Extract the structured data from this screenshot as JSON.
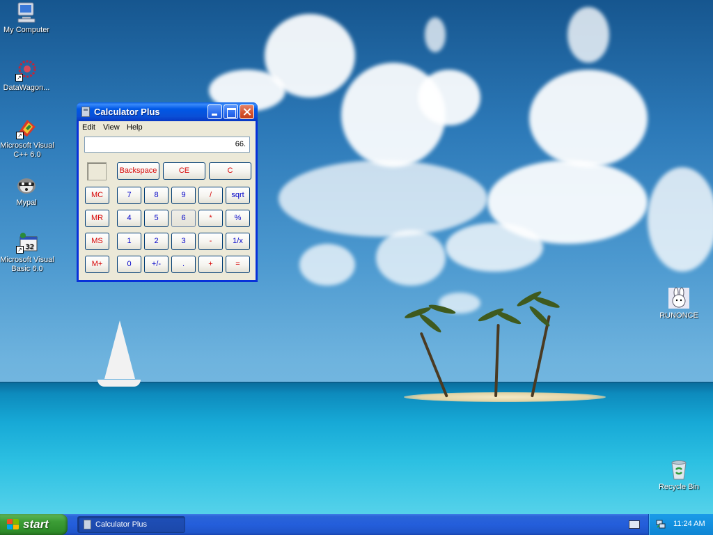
{
  "desktop": {
    "icons": [
      {
        "label": "My Computer"
      },
      {
        "label": "DataWagon..."
      },
      {
        "label": "Microsoft Visual C++ 6.0"
      },
      {
        "label": "Mypal"
      },
      {
        "label": "Microsoft Visual Basic 6.0"
      },
      {
        "label": "RUNONCE"
      },
      {
        "label": "Recycle Bin"
      }
    ]
  },
  "calculator": {
    "title": "Calculator Plus",
    "menu": [
      "Edit",
      "View",
      "Help"
    ],
    "display": "66.",
    "buttons": {
      "backspace": "Backspace",
      "ce": "CE",
      "c": "C",
      "mc": "MC",
      "mr": "MR",
      "ms": "MS",
      "mplus": "M+",
      "n7": "7",
      "n8": "8",
      "n9": "9",
      "div": "/",
      "sqrt": "sqrt",
      "n4": "4",
      "n5": "5",
      "n6": "6",
      "mul": "*",
      "pct": "%",
      "n1": "1",
      "n2": "2",
      "n3": "3",
      "sub": "-",
      "inv": "1/x",
      "n0": "0",
      "sign": "+/-",
      "dot": ".",
      "add": "+",
      "eq": "="
    }
  },
  "taskbar": {
    "start_label": "start",
    "task_label": "Calculator Plus",
    "clock": "11:24 AM"
  },
  "colors": {
    "titlebar": "#0058e6",
    "taskbar": "#245edb",
    "start": "#3c9d36",
    "op_text": "#d60000",
    "digit_text": "#0000c8"
  }
}
